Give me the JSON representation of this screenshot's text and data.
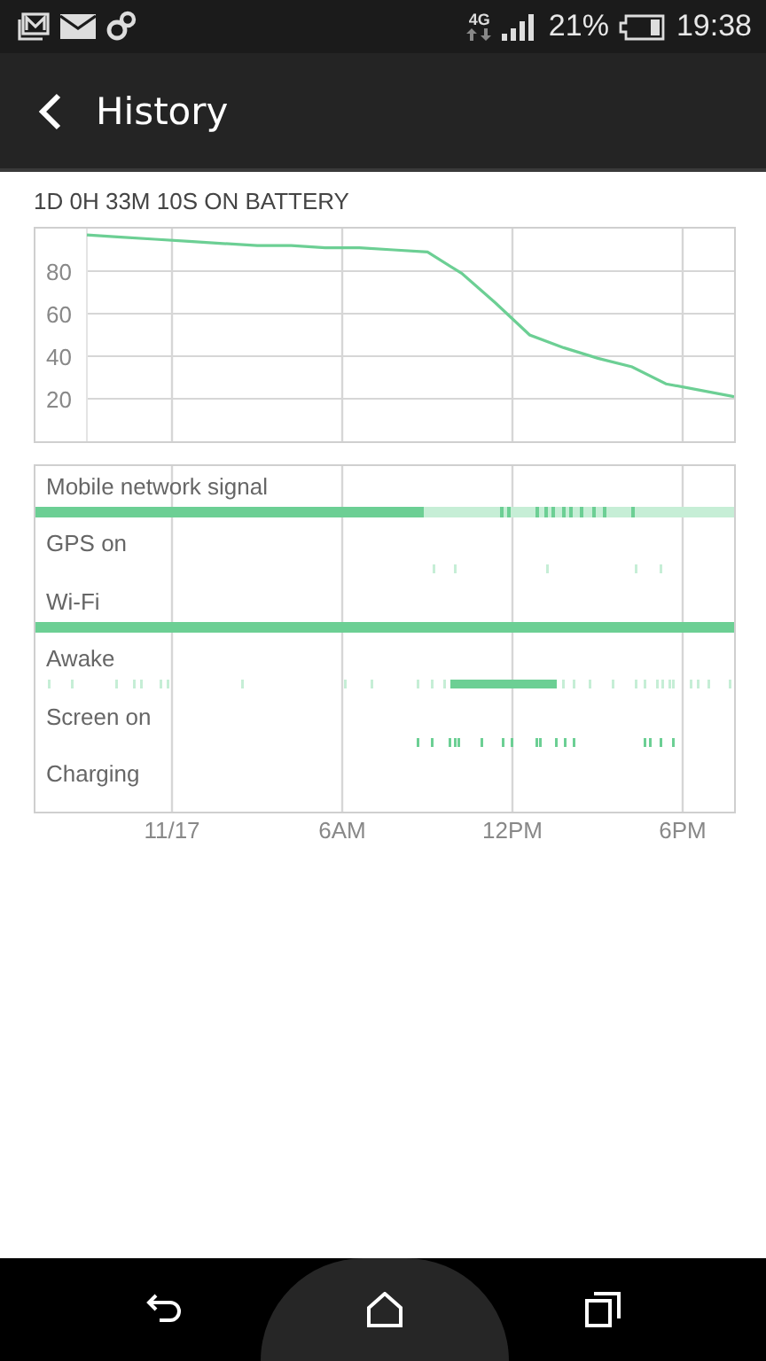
{
  "status_bar": {
    "network": "4G",
    "battery": "21%",
    "time": "19:38"
  },
  "app_bar": {
    "title": "History"
  },
  "summary": "1D 0H 33M 10S ON BATTERY",
  "battery_chart": {
    "chart_data": {
      "type": "line",
      "categories": [
        null,
        null,
        null,
        null,
        null,
        null,
        null,
        null,
        null,
        null,
        null,
        null,
        null,
        null,
        null,
        null,
        null,
        null,
        null,
        null
      ],
      "series": [
        {
          "color": "#6ccf94",
          "values": [
            97,
            96,
            95,
            94,
            93,
            92,
            92,
            91,
            91,
            90,
            89,
            79,
            65,
            50,
            44,
            39,
            35,
            27,
            24,
            21
          ]
        }
      ],
      "ylim": [
        0,
        100
      ],
      "yticks": [
        20,
        40,
        60,
        80
      ],
      "grid": true
    }
  },
  "timeline": {
    "rows": [
      {
        "label": "Mobile network signal",
        "kind": "signal"
      },
      {
        "label": "GPS on",
        "kind": "gps"
      },
      {
        "label": "Wi-Fi",
        "kind": "wifi"
      },
      {
        "label": "Awake",
        "kind": "awake"
      },
      {
        "label": "Screen on",
        "kind": "screen"
      },
      {
        "label": "Charging",
        "kind": "charging"
      }
    ],
    "axis_labels": [
      "11/17",
      "6AM",
      "12PM",
      "6PM"
    ]
  }
}
